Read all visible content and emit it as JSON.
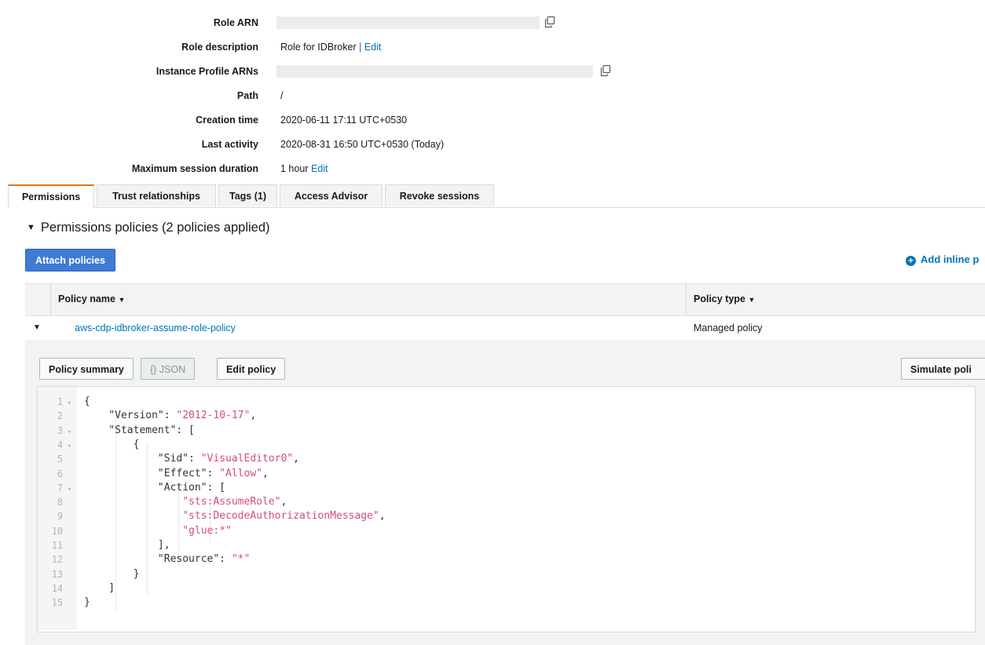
{
  "summary": {
    "role_arn_label": "Role ARN",
    "role_description_label": "Role description",
    "role_description_value": "Role for IDBroker",
    "role_description_sep": "|",
    "role_description_edit": "Edit",
    "instance_profile_label": "Instance Profile ARNs",
    "path_label": "Path",
    "path_value": "/",
    "creation_time_label": "Creation time",
    "creation_time_value": "2020-06-11 17:11 UTC+0530",
    "last_activity_label": "Last activity",
    "last_activity_value": "2020-08-31 16:50 UTC+0530 (Today)",
    "max_session_label": "Maximum session duration",
    "max_session_value": "1 hour",
    "max_session_edit": "Edit"
  },
  "tabs": [
    {
      "label": "Permissions"
    },
    {
      "label": "Trust relationships"
    },
    {
      "label": "Tags (1)"
    },
    {
      "label": "Access Advisor"
    },
    {
      "label": "Revoke sessions"
    }
  ],
  "permissions": {
    "section_title": "Permissions policies (2 policies applied)",
    "attach_button": "Attach policies",
    "add_inline": "Add inline p",
    "columns": {
      "policy_name": "Policy name",
      "policy_type": "Policy type"
    },
    "rows": [
      {
        "name": "aws-cdp-idbroker-assume-role-policy",
        "type": "Managed policy"
      }
    ]
  },
  "policy_panel": {
    "summary_button": "Policy summary",
    "json_button": "{} JSON",
    "edit_button": "Edit policy",
    "simulate_button": "Simulate poli"
  },
  "editor": {
    "lines": [
      {
        "n": "1",
        "fold": true,
        "pre": "{",
        "str": "",
        "post": ""
      },
      {
        "n": "2",
        "fold": false,
        "pre": "    \"Version\": ",
        "str": "\"2012-10-17\"",
        "post": ","
      },
      {
        "n": "3",
        "fold": true,
        "pre": "    \"Statement\": [",
        "str": "",
        "post": ""
      },
      {
        "n": "4",
        "fold": true,
        "pre": "        {",
        "str": "",
        "post": ""
      },
      {
        "n": "5",
        "fold": false,
        "pre": "            \"Sid\": ",
        "str": "\"VisualEditor0\"",
        "post": ","
      },
      {
        "n": "6",
        "fold": false,
        "pre": "            \"Effect\": ",
        "str": "\"Allow\"",
        "post": ","
      },
      {
        "n": "7",
        "fold": true,
        "pre": "            \"Action\": [",
        "str": "",
        "post": ""
      },
      {
        "n": "8",
        "fold": false,
        "pre": "                ",
        "str": "\"sts:AssumeRole\"",
        "post": ","
      },
      {
        "n": "9",
        "fold": false,
        "pre": "                ",
        "str": "\"sts:DecodeAuthorizationMessage\"",
        "post": ","
      },
      {
        "n": "10",
        "fold": false,
        "pre": "                ",
        "str": "\"glue:*\"",
        "post": ""
      },
      {
        "n": "11",
        "fold": false,
        "pre": "            ],",
        "str": "",
        "post": ""
      },
      {
        "n": "12",
        "fold": false,
        "pre": "            \"Resource\": ",
        "str": "\"*\"",
        "post": ""
      },
      {
        "n": "13",
        "fold": false,
        "pre": "        }",
        "str": "",
        "post": ""
      },
      {
        "n": "14",
        "fold": false,
        "pre": "    ]",
        "str": "",
        "post": ""
      },
      {
        "n": "15",
        "fold": false,
        "pre": "}",
        "str": "",
        "post": ""
      }
    ]
  },
  "colors": {
    "accent": "#0073bb",
    "primary_button": "#3f7ad6",
    "active_tab": "#ec7211",
    "json_string": "#d14f6e"
  },
  "icons": {
    "copy": "copy-icon",
    "add": "plus-circle-icon",
    "sort": "caret-down-icon",
    "expand": "caret-down-icon"
  }
}
